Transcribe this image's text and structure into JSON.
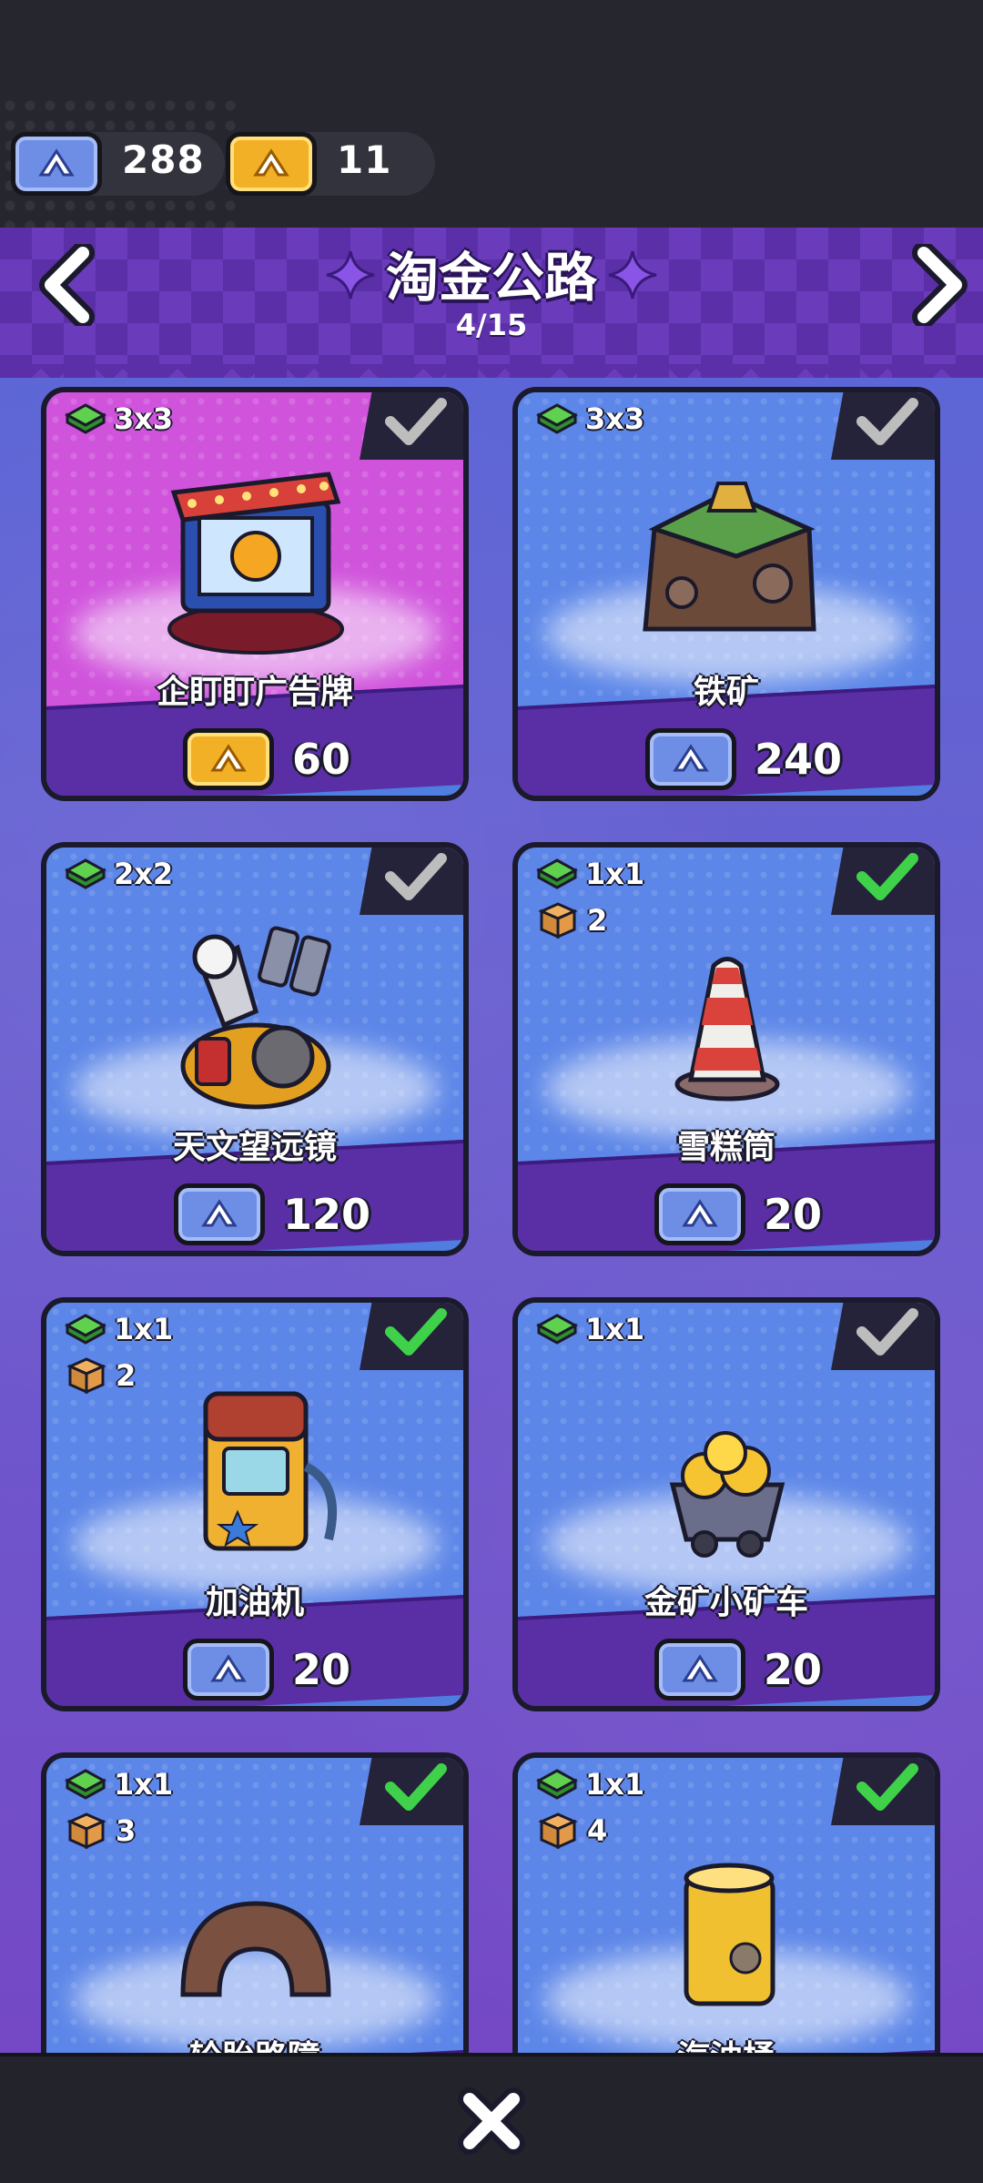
{
  "currency": {
    "blue_tickets": "288",
    "gold_tickets": "11"
  },
  "header": {
    "title": "淘金公路",
    "progress": "4/15"
  },
  "items": [
    {
      "size": "3x3",
      "boxes": "",
      "name": "企盯盯广告牌",
      "currency": "gold",
      "price": "60",
      "owned": false,
      "theme": "pink"
    },
    {
      "size": "3x3",
      "boxes": "",
      "name": "铁矿",
      "currency": "blue",
      "price": "240",
      "owned": false,
      "theme": "blue"
    },
    {
      "size": "2x2",
      "boxes": "",
      "name": "天文望远镜",
      "currency": "blue",
      "price": "120",
      "owned": false,
      "theme": "blue"
    },
    {
      "size": "1x1",
      "boxes": "2",
      "name": "雪糕筒",
      "currency": "blue",
      "price": "20",
      "owned": true,
      "theme": "blue"
    },
    {
      "size": "1x1",
      "boxes": "2",
      "name": "加油机",
      "currency": "blue",
      "price": "20",
      "owned": true,
      "theme": "blue"
    },
    {
      "size": "1x1",
      "boxes": "",
      "name": "金矿小矿车",
      "currency": "blue",
      "price": "20",
      "owned": false,
      "theme": "blue"
    },
    {
      "size": "1x1",
      "boxes": "3",
      "name": "轮胎路障",
      "currency": "blue",
      "price": "",
      "owned": true,
      "theme": "blue"
    },
    {
      "size": "1x1",
      "boxes": "4",
      "name": "汽油桶",
      "currency": "blue",
      "price": "",
      "owned": true,
      "theme": "blue"
    }
  ],
  "colors": {
    "blue_ticket": "#6e8ee6",
    "gold_ticket": "#f2b026",
    "check_owned": "#3fd14a",
    "check_not_owned": "#bdbdbd",
    "header_purple": "#5b2fa8"
  },
  "icons": [
    "blue-ticket-icon",
    "gold-ticket-icon",
    "chevron-left-icon",
    "chevron-right-icon",
    "sparkle-icon",
    "gem-icon",
    "box-icon",
    "check-icon",
    "close-icon"
  ]
}
